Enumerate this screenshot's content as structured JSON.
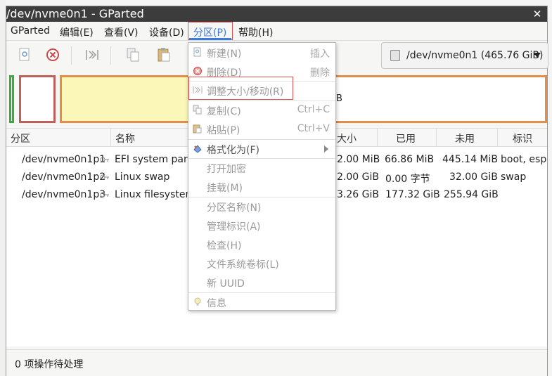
{
  "window": {
    "title": "/dev/nvme0n1 - GParted"
  },
  "menubar": {
    "items": [
      "GParted",
      "编辑(E)",
      "查看(V)",
      "设备(D)",
      "分区(P)",
      "帮助(H)"
    ]
  },
  "toolbar": {
    "device_label": "/dev/nvme0n1 (465.76 GiB)"
  },
  "partition_map": {
    "p3_label": "B"
  },
  "table": {
    "headers": [
      "分区",
      "名称",
      "大小",
      "已用",
      "未用",
      "标识"
    ],
    "rows": [
      {
        "partition": "/dev/nvme0n1p1",
        "name": "EFI system parti",
        "size": "2.00 MiB",
        "used": "66.86 MiB",
        "unused": "445.14 MiB",
        "flags": "boot, esp"
      },
      {
        "partition": "/dev/nvme0n1p2",
        "name": "Linux swap",
        "size": "2.00 GiB",
        "used": "0.00 字节",
        "unused": "32.00 GiB",
        "flags": "swap"
      },
      {
        "partition": "/dev/nvme0n1p3",
        "name": "Linux filesystem",
        "size": "3.26 GiB",
        "used": "177.32 GiB",
        "unused": "255.94 GiB",
        "flags": ""
      }
    ]
  },
  "status": {
    "text": "0 项操作待处理"
  },
  "partition_menu": {
    "items": [
      {
        "label": "新建(N)",
        "accel": "插入",
        "icon": "new-icon"
      },
      {
        "label": "删除(D)",
        "accel": "删除",
        "icon": "delete-icon"
      },
      {
        "label": "调整大小/移动(R)",
        "accel": "",
        "icon": "resize-icon"
      },
      {
        "label": "复制(C)",
        "accel": "Ctrl+C",
        "icon": "copy-icon"
      },
      {
        "label": "粘贴(P)",
        "accel": "Ctrl+V",
        "icon": "paste-icon"
      },
      {
        "label": "格式化为(F)",
        "accel": "",
        "icon": "format-icon"
      },
      {
        "label": "打开加密",
        "accel": ""
      },
      {
        "label": "挂载(M)",
        "accel": ""
      },
      {
        "label": "分区名称(N)",
        "accel": ""
      },
      {
        "label": "管理标识(A)",
        "accel": ""
      },
      {
        "label": "检查(H)",
        "accel": ""
      },
      {
        "label": "文件系统卷标(L)",
        "accel": ""
      },
      {
        "label": "新 UUID",
        "accel": ""
      },
      {
        "label": "信息",
        "accel": "",
        "icon": "info-icon"
      }
    ]
  },
  "colors": {
    "p1": "#3caa3c",
    "p2": "#c0605a",
    "p3": "#e38d47",
    "used": "#fbf7b8",
    "accent": "#3d7bd9",
    "highlight": "#e05050"
  }
}
